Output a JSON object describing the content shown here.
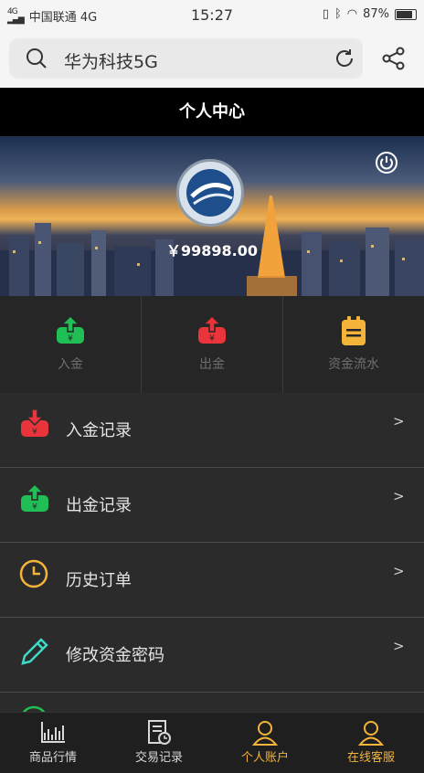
{
  "status_bar": {
    "network_label": "4G",
    "carrier": "中国联通 4G",
    "time": "15:27",
    "battery": "87%"
  },
  "browser": {
    "search_text": "华为科技5G"
  },
  "header": {
    "title": "个人中心"
  },
  "banner": {
    "balance": "￥99898.00"
  },
  "quick_actions": [
    {
      "label": "入金",
      "icon": "deposit-icon"
    },
    {
      "label": "出金",
      "icon": "withdraw-icon"
    },
    {
      "label": "资金流水",
      "icon": "clipboard-icon"
    }
  ],
  "menu": [
    {
      "label": "入金记录",
      "arrow": ">",
      "icon": "deposit-record-icon"
    },
    {
      "label": "出金记录",
      "arrow": ">",
      "icon": "withdraw-record-icon"
    },
    {
      "label": "历史订单",
      "arrow": ">",
      "icon": "clock-icon"
    },
    {
      "label": "修改资金密码",
      "arrow": ">",
      "icon": "pencil-icon"
    }
  ],
  "tabs": [
    {
      "label": "商品行情",
      "icon": "chart-icon"
    },
    {
      "label": "交易记录",
      "icon": "record-icon"
    },
    {
      "label": "个人账户",
      "icon": "user-icon",
      "active": true
    },
    {
      "label": "在线客服",
      "icon": "user-icon"
    }
  ],
  "colors": {
    "accent": "#f4b43a",
    "green": "#1fbf55",
    "red": "#e8343a",
    "header_bg": "#000000"
  }
}
